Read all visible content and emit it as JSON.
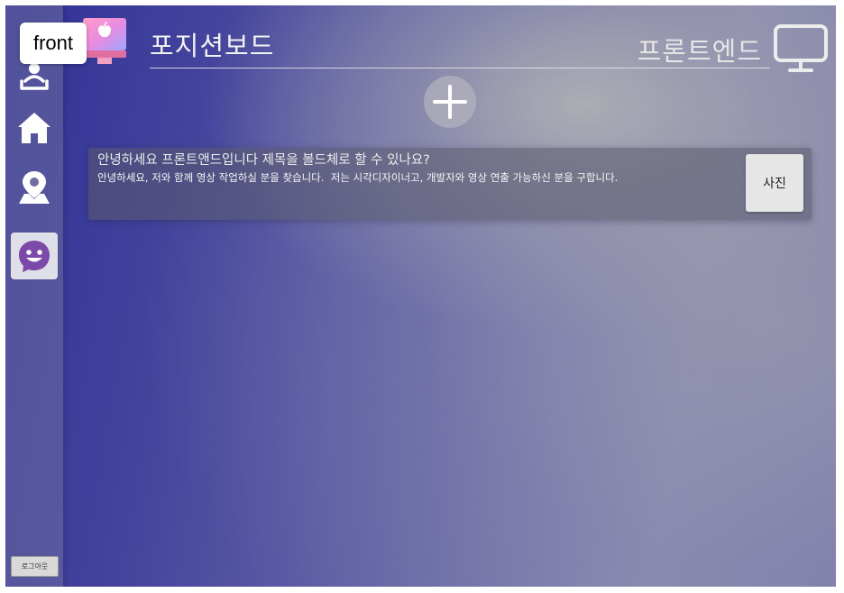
{
  "badge": {
    "label": "front"
  },
  "header": {
    "title": "포지션보드",
    "position": "프론트엔드"
  },
  "sidebar": {
    "items": [
      {
        "icon": "user-network-icon"
      },
      {
        "icon": "home-icon"
      },
      {
        "icon": "map-pin-icon"
      },
      {
        "icon": "chat-smile-icon",
        "active": true
      }
    ],
    "logout_label": "로그아웃"
  },
  "posts": [
    {
      "title": "안녕하세요 프론트앤드입니다 제목을 볼드체로 할 수 있나요?",
      "body": "안녕하세요, 저와 함께 영상 작업하실 분을 찾습니다.  저는 시각디자이너고, 개발자와 영상 연출 가능하신 분을 구합니다.",
      "photo_label": "사진"
    }
  ],
  "colors": {
    "background_start": "#303096",
    "background_end": "#8a8ab0",
    "sidebar": "#6e6ea0",
    "icon": "#ffffff",
    "active_icon": "#7b4aa8"
  }
}
